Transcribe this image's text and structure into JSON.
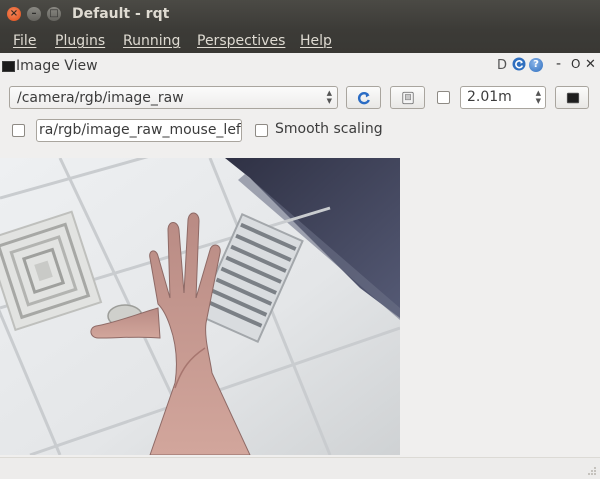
{
  "window": {
    "title": "Default - rqt"
  },
  "menubar": {
    "items": [
      "File",
      "Plugins",
      "Running",
      "Perspectives",
      "Help"
    ]
  },
  "plugin": {
    "title": "Image View",
    "d_label": "D",
    "help_glyph": "?",
    "min_glyph": "-",
    "float_glyph": "O",
    "close_glyph": "✕"
  },
  "toolbar": {
    "topic": "/camera/rgb/image_raw",
    "zoom_value": "2.01m"
  },
  "row2": {
    "mouse_topic": "ra/rgb/image_raw_mouse_left",
    "smooth_label": "Smooth scaling"
  },
  "colors": {
    "titlebar": "#3c3b37",
    "close_button": "#df4b16",
    "accent": "#2f6fbf"
  },
  "icons": [
    "close-icon",
    "minimize-icon",
    "maximize-icon",
    "reload-icon",
    "help-icon",
    "save-icon",
    "color-scheme-icon"
  ]
}
